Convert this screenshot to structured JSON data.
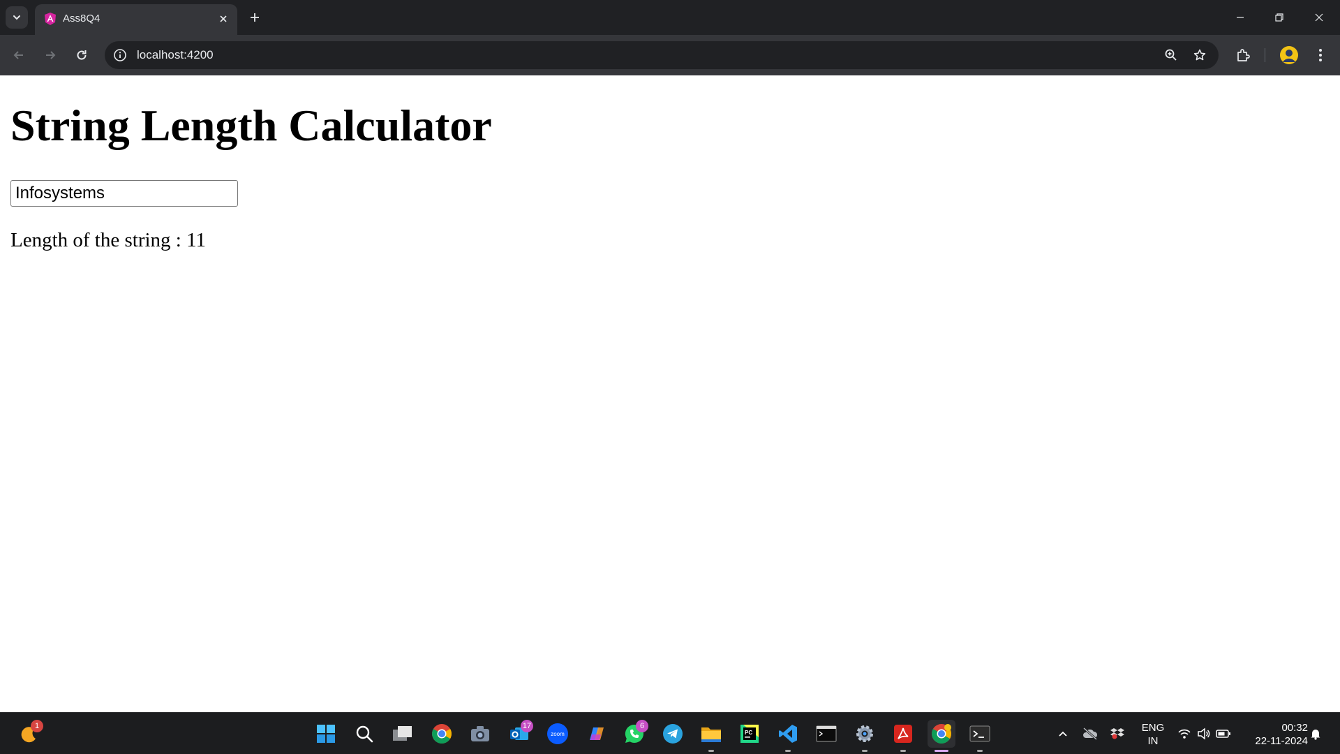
{
  "browser": {
    "tab": {
      "title": "Ass8Q4"
    },
    "omnibox": {
      "url": "localhost:4200"
    }
  },
  "page": {
    "heading": "String Length Calculator",
    "input": {
      "value": "Infosystems"
    },
    "result": "Length of the string : 11"
  },
  "taskbar": {
    "weather_badge": "1",
    "outlook_badge": "17",
    "whatsapp_badge": "6",
    "zoom_label": "zoom",
    "pycharm_label": "PC",
    "language": {
      "line1": "ENG",
      "line2": "IN"
    },
    "clock": {
      "time": "00:32",
      "date": "22-11-2024"
    }
  },
  "colors": {
    "tabstrip": "#202124",
    "toolbar": "#35363a",
    "taskbar": "#1c1d1f",
    "badge": "#c64fc4"
  }
}
